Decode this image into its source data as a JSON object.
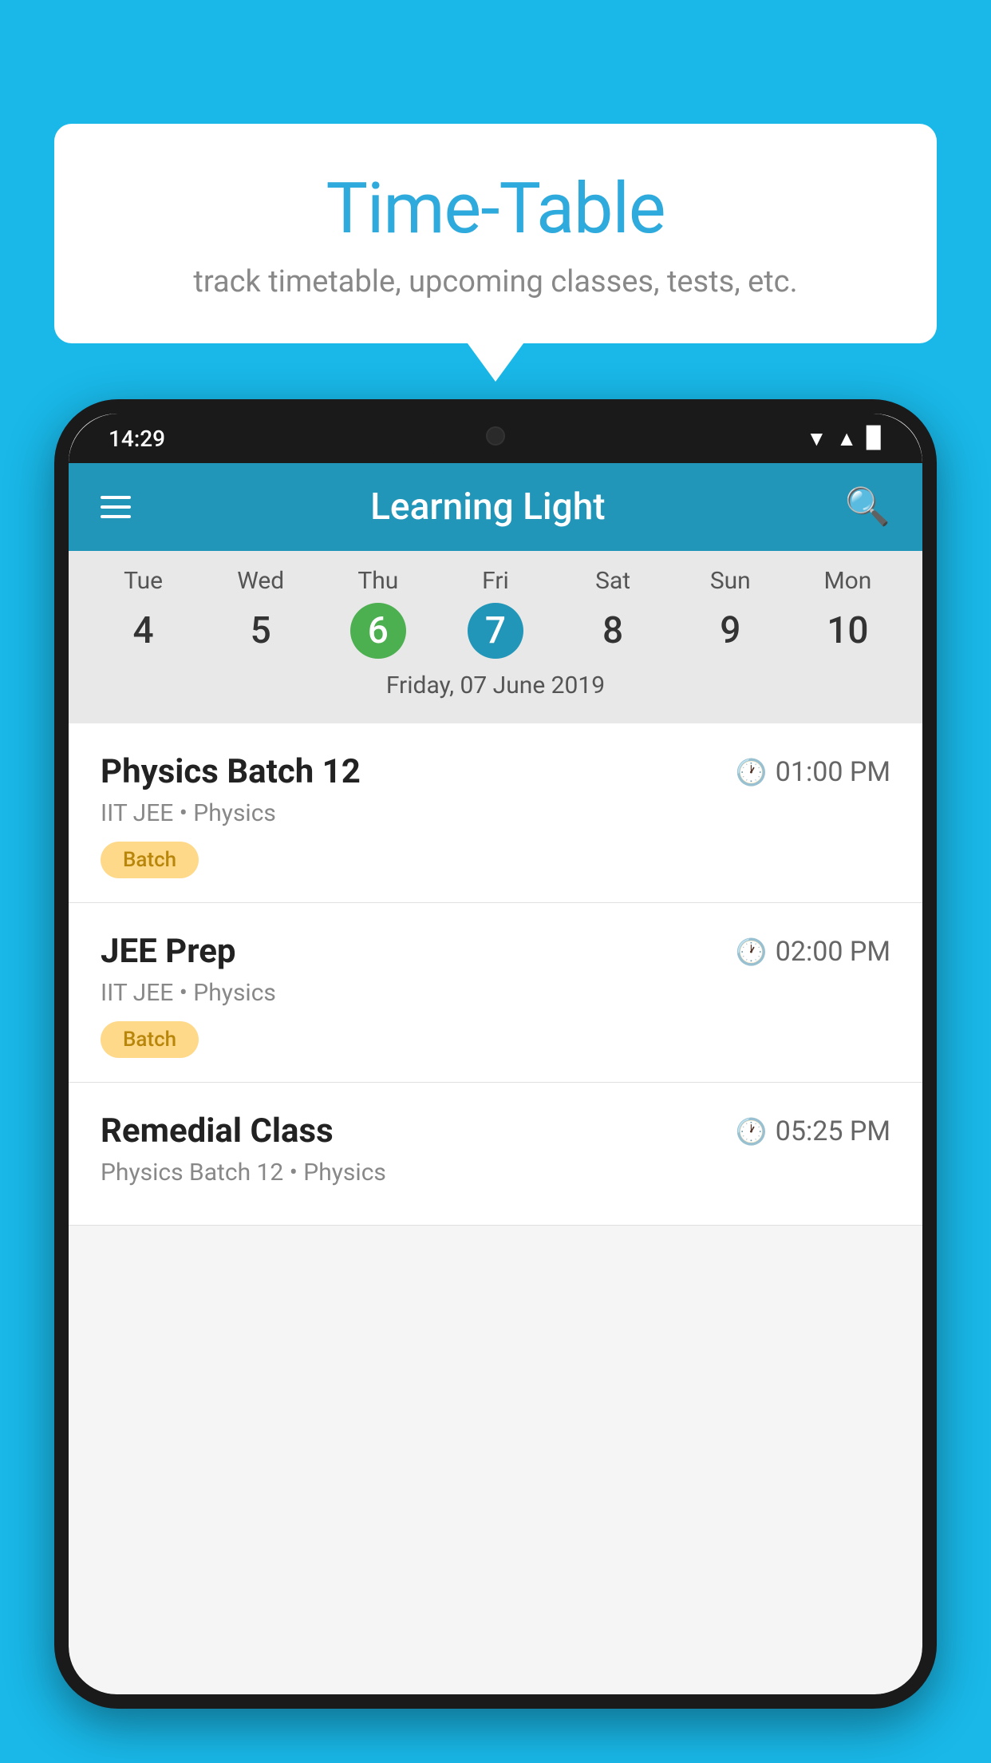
{
  "background_color": "#19b8e8",
  "speech_bubble": {
    "title": "Time-Table",
    "subtitle": "track timetable, upcoming classes, tests, etc."
  },
  "phone": {
    "status_bar": {
      "time": "14:29"
    },
    "app_header": {
      "title": "Learning Light"
    },
    "calendar": {
      "days": [
        "Tue",
        "Wed",
        "Thu",
        "Fri",
        "Sat",
        "Sun",
        "Mon"
      ],
      "dates": [
        "4",
        "5",
        "6",
        "7",
        "8",
        "9",
        "10"
      ],
      "today_index": 2,
      "selected_index": 3,
      "selected_date_label": "Friday, 07 June 2019"
    },
    "schedule": [
      {
        "name": "Physics Batch 12",
        "time": "01:00 PM",
        "subtitle": "IIT JEE • Physics",
        "badge": "Batch"
      },
      {
        "name": "JEE Prep",
        "time": "02:00 PM",
        "subtitle": "IIT JEE • Physics",
        "badge": "Batch"
      },
      {
        "name": "Remedial Class",
        "time": "05:25 PM",
        "subtitle": "Physics Batch 12 • Physics",
        "badge": ""
      }
    ]
  }
}
